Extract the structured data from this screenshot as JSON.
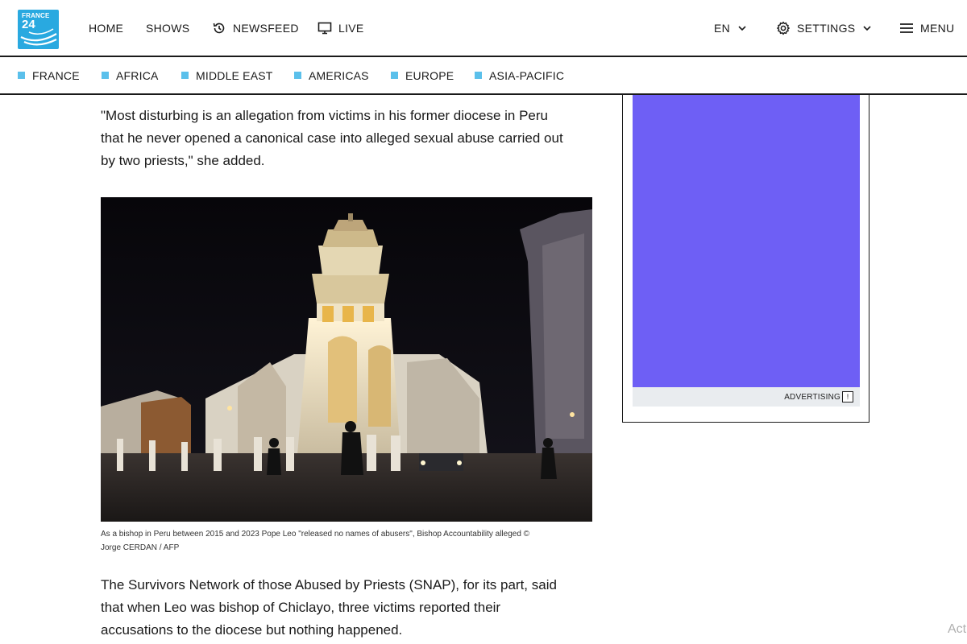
{
  "header": {
    "logo_line1": "FRANCE",
    "logo_line2": "24",
    "nav": {
      "home": "HOME",
      "shows": "SHOWS",
      "newsfeed": "NEWSFEED",
      "live": "LIVE"
    },
    "language": "EN",
    "settings": "SETTINGS",
    "menu": "MENU"
  },
  "sections": [
    "FRANCE",
    "AFRICA",
    "MIDDLE EAST",
    "AMERICAS",
    "EUROPE",
    "ASIA-PACIFIC"
  ],
  "article": {
    "paragraph1_lines": [
      "\"Most disturbing is an allegation from victims in his former diocese in Peru",
      "that he never opened a canonical case into alleged sexual abuse carried out",
      "by two priests,\" she added."
    ],
    "caption_lines": [
      "As a bishop in Peru between 2015 and 2023 Pope Leo \"released no names of abusers\", Bishop Accountability alleged ©",
      "Jorge CERDAN / AFP"
    ],
    "paragraph2_lines": [
      "The Survivors Network of those Abused by Priests (SNAP), for its part, said",
      "that when Leo was bishop of Chiclayo, three victims reported their",
      "accusations to the diocese but nothing happened."
    ]
  },
  "ad": {
    "label": "ADVERTISING",
    "icon_glyph": "!"
  },
  "corner_text": "Act",
  "colors": {
    "brand": "#29a9e0",
    "section_square": "#5bc0eb",
    "ad_fill": "#6e5ff5"
  }
}
